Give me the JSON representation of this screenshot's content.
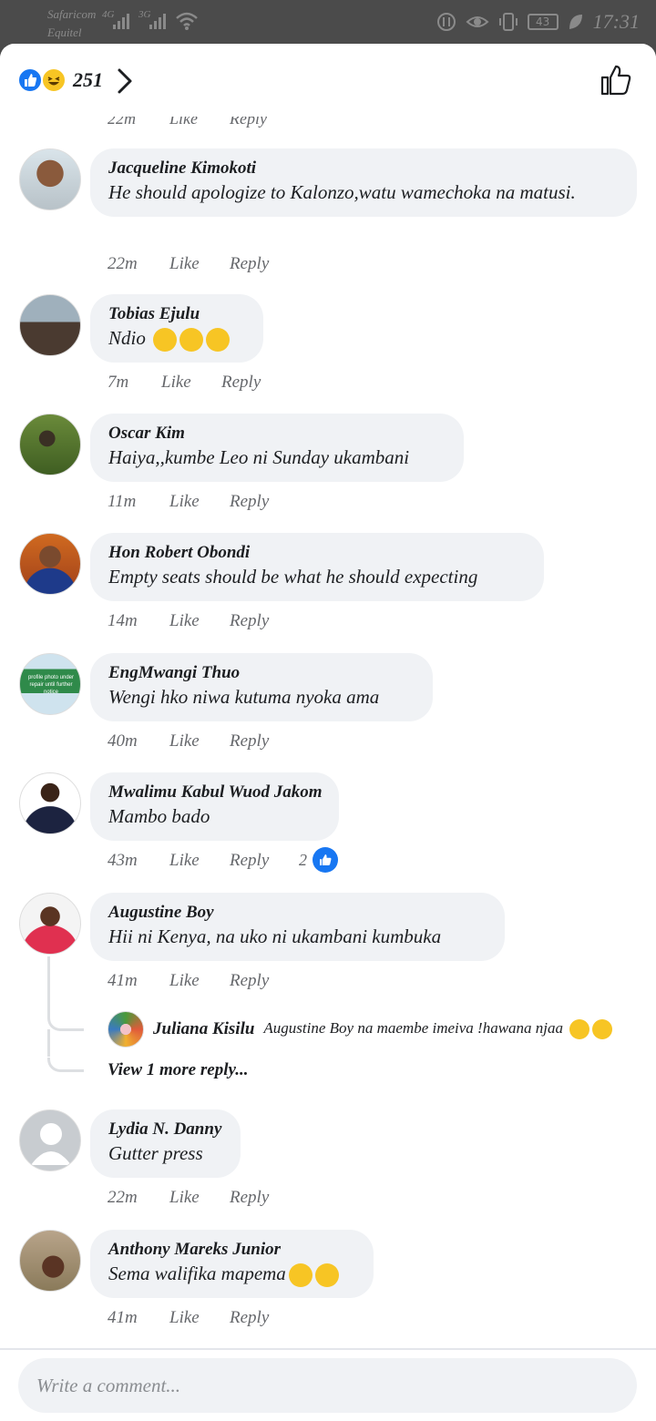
{
  "status_bar": {
    "carrier_1": "Safaricom",
    "carrier_2": "Equitel",
    "net_1": "4G",
    "net_2": "3G",
    "battery": "43",
    "time": "17:31"
  },
  "header": {
    "reaction_count": "251",
    "icons": [
      "like-reaction-icon",
      "haha-reaction-icon",
      "chevron-right-icon",
      "thumbs-up-outline-icon"
    ]
  },
  "partial_comment": {
    "time": "22m",
    "like": "Like",
    "reply": "Reply"
  },
  "comments": [
    {
      "author": "Jacqueline Kimokoti",
      "text": "He should apologize to Kalonzo,watu wamechoka na matusi.",
      "time": "22m",
      "like": "Like",
      "reply": "Reply"
    },
    {
      "author": "Tobias Ejulu",
      "text": "Ndio",
      "time": "7m",
      "like": "Like",
      "reply": "Reply"
    },
    {
      "author": "Oscar Kim",
      "text": "Haiya,,kumbe Leo ni Sunday ukambani",
      "time": "11m",
      "like": "Like",
      "reply": "Reply"
    },
    {
      "author": "Hon Robert Obondi",
      "text": "Empty seats should be what he should expecting",
      "time": "14m",
      "like": "Like",
      "reply": "Reply"
    },
    {
      "author": "EngMwangi Thuo",
      "text": "Wengi hko niwa kutuma nyoka ama",
      "time": "40m",
      "like": "Like",
      "reply": "Reply",
      "avatar_caption": "profile photo under repair until further notice"
    },
    {
      "author": "Mwalimu Kabul Wuod Jakom",
      "text": "Mambo bado",
      "time": "43m",
      "like": "Like",
      "reply": "Reply",
      "likes": "2"
    },
    {
      "author": "Augustine Boy",
      "text": "Hii ni Kenya, na uko ni ukambani kumbuka",
      "time": "41m",
      "like": "Like",
      "reply": "Reply"
    },
    {
      "author": "Lydia N. Danny",
      "text": "Gutter press",
      "time": "22m",
      "like": "Like",
      "reply": "Reply"
    },
    {
      "author": "Anthony Mareks Junior",
      "text": "Sema walifika mapema",
      "time": "41m",
      "like": "Like",
      "reply": "Reply"
    }
  ],
  "reply_preview": {
    "author": "Juliana Kisilu",
    "text": "Augustine Boy na maembe imeiva !hawana njaa",
    "view_more": "View 1 more reply..."
  },
  "composer": {
    "placeholder": "Write a comment..."
  },
  "colors": {
    "accent": "#1877f2",
    "bubble": "#f0f2f5",
    "meta": "#65676b",
    "emoji": "#f7c524"
  }
}
